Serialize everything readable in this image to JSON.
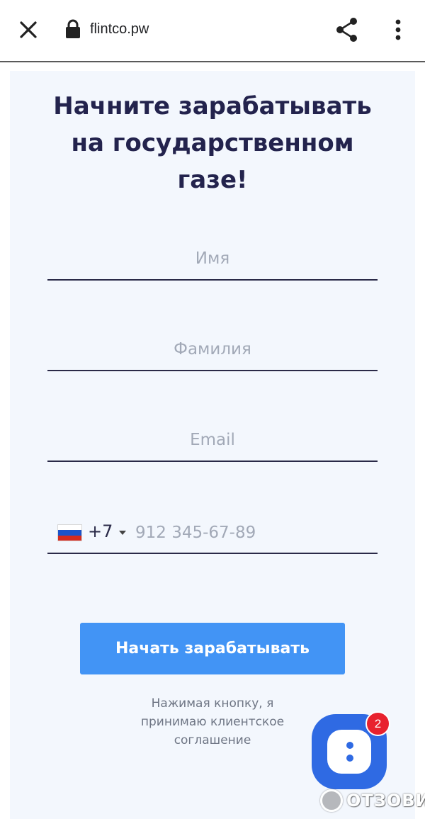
{
  "browser": {
    "url": "flintco.pw",
    "icons": [
      "close-icon",
      "lock-icon",
      "share-icon",
      "more-vert-icon"
    ]
  },
  "form": {
    "headline": "Начните зарабатывать на государственном газе!",
    "first_name_placeholder": "Имя",
    "last_name_placeholder": "Фамилия",
    "email_placeholder": "Email",
    "phone": {
      "country_code": "+7",
      "placeholder": "912 345-67-89",
      "flag_colors": [
        "#ffffff",
        "#1c53c9",
        "#d52b1e"
      ]
    },
    "submit_label": "Начать зарабатывать",
    "agreement_text": "Нажимая кнопку, я принимаю клиентское соглашение"
  },
  "chat": {
    "badge_count": "2"
  },
  "watermark": {
    "text": "ОТЗОВИК"
  },
  "colors": {
    "accent": "#4294f5",
    "headline": "#23234d",
    "chat": "#2f6ae3",
    "badge": "#e8222e"
  }
}
